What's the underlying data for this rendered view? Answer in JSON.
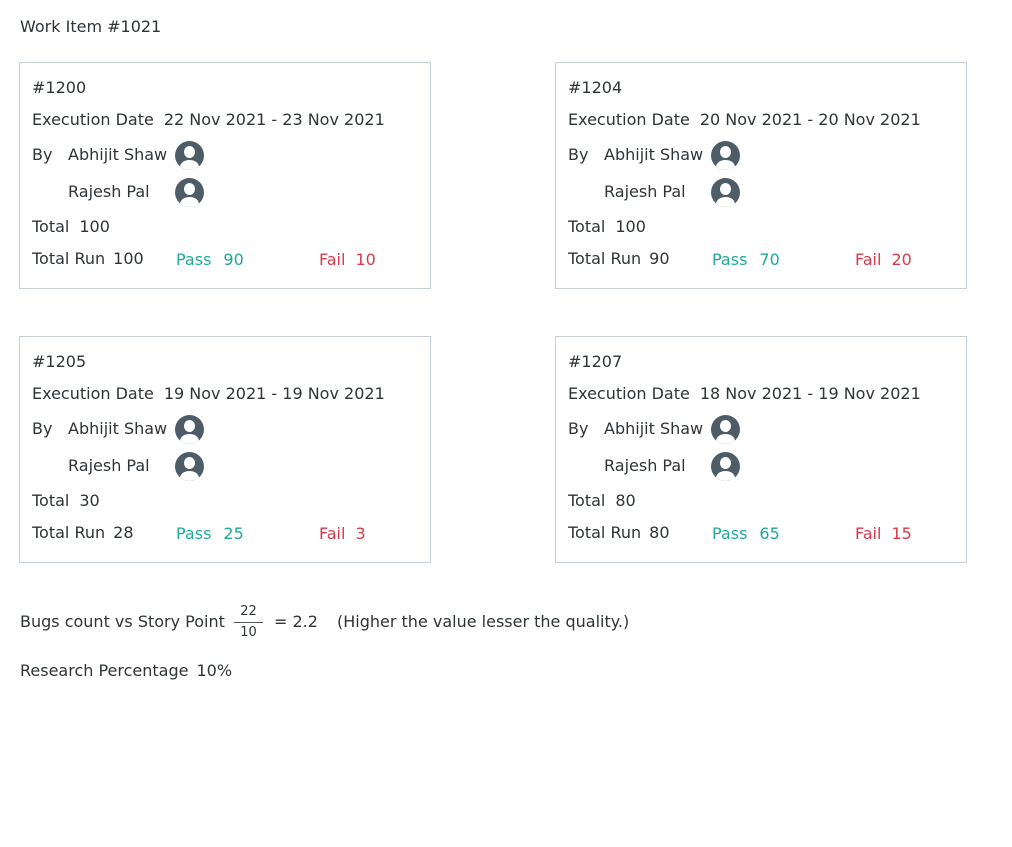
{
  "title": "Work Item #1021",
  "labels": {
    "execution_date": "Execution Date",
    "by": "By",
    "total": "Total",
    "total_run": "Total Run",
    "pass": "Pass",
    "fail": "Fail"
  },
  "cards": [
    {
      "id": "#1200",
      "execution_date": "22 Nov 2021 - 23 Nov 2021",
      "people": [
        "Abhijit Shaw",
        "Rajesh Pal"
      ],
      "total": "100",
      "total_run": "100",
      "pass": "90",
      "fail": "10"
    },
    {
      "id": "#1204",
      "execution_date": "20 Nov 2021 - 20 Nov 2021",
      "people": [
        "Abhijit Shaw",
        "Rajesh Pal"
      ],
      "total": "100",
      "total_run": "90",
      "pass": "70",
      "fail": "20"
    },
    {
      "id": "#1205",
      "execution_date": "19 Nov 2021 - 19 Nov 2021",
      "people": [
        "Abhijit Shaw",
        "Rajesh Pal"
      ],
      "total": "30",
      "total_run": "28",
      "pass": "25",
      "fail": "3"
    },
    {
      "id": "#1207",
      "execution_date": "18 Nov 2021 - 19 Nov 2021",
      "people": [
        "Abhijit Shaw",
        "Rajesh Pal"
      ],
      "total": "80",
      "total_run": "80",
      "pass": "65",
      "fail": "15"
    }
  ],
  "bugs": {
    "label": "Bugs count vs Story Point",
    "numerator": "22",
    "denominator": "10",
    "result": "= 2.2",
    "note": "(Higher the value lesser the quality.)"
  },
  "research": {
    "label": "Research Percentage",
    "value": "10%"
  },
  "colors": {
    "pass": "#1fa99a",
    "fail": "#d9394d",
    "border": "#c7d0da",
    "avatar": "#4e5c68"
  },
  "icons": [
    "user-avatar-icon"
  ]
}
